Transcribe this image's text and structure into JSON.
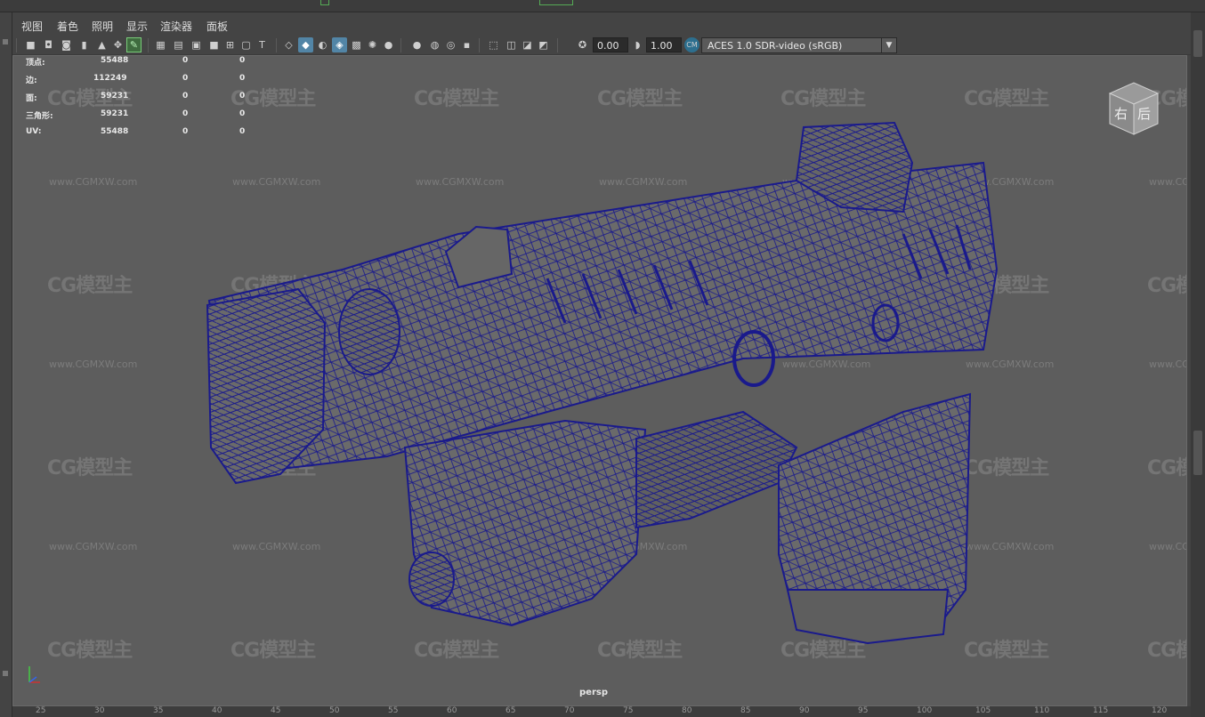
{
  "menu": {
    "items": [
      {
        "label": "视图"
      },
      {
        "label": "着色"
      },
      {
        "label": "照明"
      },
      {
        "label": "显示"
      },
      {
        "label": "渲染器"
      },
      {
        "label": "面板"
      }
    ]
  },
  "toolbar": {
    "exposure_value": "0.00",
    "gamma_value": "1.00",
    "color_space": "ACES 1.0 SDR-video (sRGB)"
  },
  "hud": {
    "rows": [
      {
        "label": "顶点:",
        "value": "55488",
        "sel": "0",
        "uv": "0"
      },
      {
        "label": "边:",
        "value": "112249",
        "sel": "0",
        "uv": "0"
      },
      {
        "label": "面:",
        "value": "59231",
        "sel": "0",
        "uv": "0"
      },
      {
        "label": "三角形:",
        "value": "59231",
        "sel": "0",
        "uv": "0"
      },
      {
        "label": "UV:",
        "value": "55488",
        "sel": "0",
        "uv": "0"
      }
    ]
  },
  "viewport": {
    "camera_label": "persp",
    "viewcube_faces": {
      "right": "右",
      "back": "后"
    },
    "mesh_color": "#1a1a8c",
    "background_color": "#5d5d5d"
  },
  "watermark": {
    "logo": "CG模型主",
    "url": "www.CGMXW.com"
  },
  "ruler": {
    "ticks": [
      "25",
      "30",
      "35",
      "40",
      "45",
      "50",
      "55",
      "60",
      "65",
      "70",
      "75",
      "80",
      "85",
      "90",
      "95",
      "100",
      "105",
      "110",
      "115",
      "120"
    ]
  },
  "icons": [
    "camera-icon",
    "lock-camera-icon",
    "bookmark-icon",
    "image-plane-icon",
    "grid-icon",
    "film-gate-icon",
    "resolution-gate-icon",
    "gate-mask-icon",
    "safe-action-icon",
    "wireframe-icon",
    "smooth-shade-icon",
    "wireframe-on-shaded-icon",
    "textured-icon",
    "lights-icon",
    "shadows-icon",
    "ambient-occlusion-icon",
    "motion-blur-icon",
    "antialias-icon",
    "isolate-select-icon",
    "xray-icon",
    "xray-joints-icon",
    "backface-icon",
    "exposure-icon",
    "gamma-icon",
    "color-management-icon"
  ]
}
